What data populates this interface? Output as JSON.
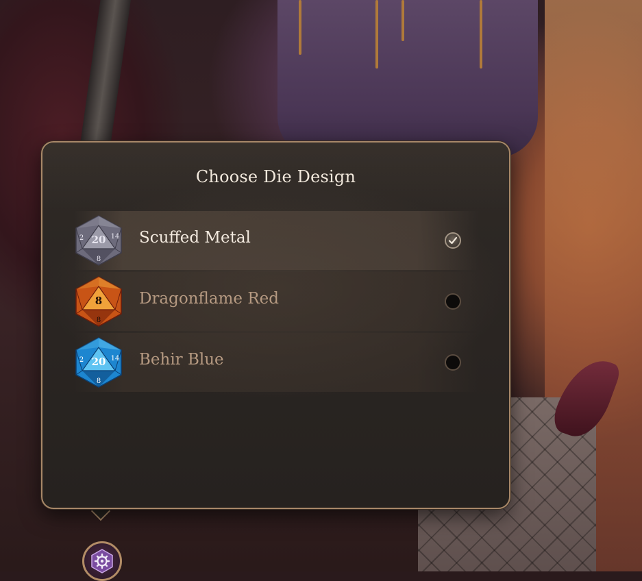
{
  "panel": {
    "title": "Choose Die Design"
  },
  "dice": [
    {
      "label": "Scuffed Metal",
      "icon": "d20-scuffed-metal-icon",
      "face_top": "20",
      "face_bottom": "8",
      "face_side_left": "2",
      "face_side_right": "14",
      "selected": true,
      "colors": {
        "light": "#9b9aa8",
        "mid": "#6d6b7c",
        "dark": "#3e3c4a",
        "number": "#e8e6f0"
      }
    },
    {
      "label": "Dragonflame Red",
      "icon": "d20-dragonflame-red-icon",
      "face_top": "8",
      "face_bottom": "8",
      "face_side_left": "",
      "face_side_right": "",
      "selected": false,
      "colors": {
        "light": "#f0a23a",
        "mid": "#c85416",
        "dark": "#6d1c0a",
        "number": "#1c0c06"
      }
    },
    {
      "label": "Behir Blue",
      "icon": "d20-behir-blue-icon",
      "face_top": "20",
      "face_bottom": "8",
      "face_side_left": "2",
      "face_side_right": "14",
      "selected": false,
      "colors": {
        "light": "#5ec3f2",
        "mid": "#1d86d0",
        "dark": "#0b3f72",
        "number": "#ffffff"
      }
    }
  ],
  "settings_button": {
    "icon": "gear-icon"
  }
}
